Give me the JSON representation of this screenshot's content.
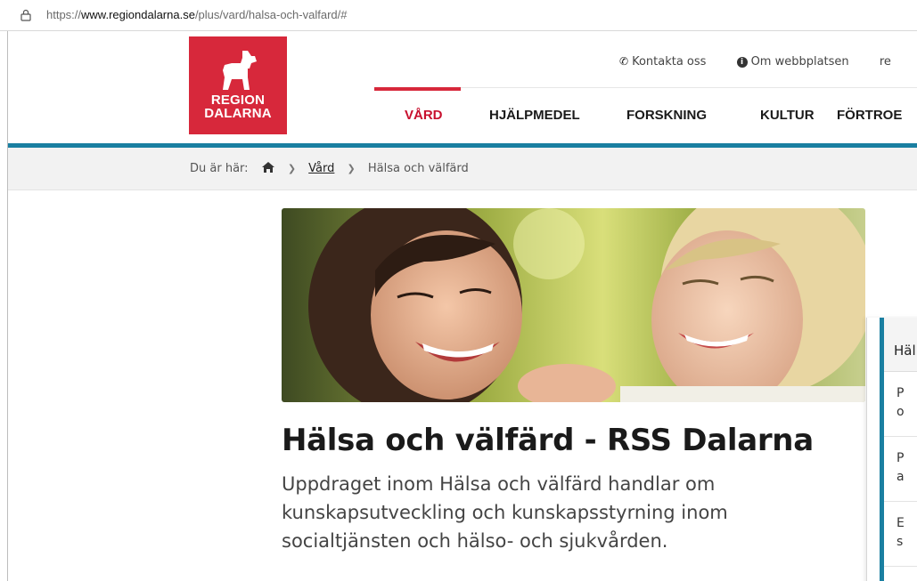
{
  "browser": {
    "url_protocol": "https://",
    "url_host": "www.regiondalarna.se",
    "url_path": "/plus/vard/halsa-och-valfard/#"
  },
  "header": {
    "logo_line1": "REGION",
    "logo_line2": "DALARNA",
    "top_links": {
      "contact": "Kontakta oss",
      "about": "Om webbplatsen",
      "more": "re"
    },
    "main_nav": [
      "VÅRD",
      "HJÄLPMEDEL",
      "FORSKNING",
      "KULTUR",
      "FÖRTROE"
    ],
    "active_index": 0
  },
  "breadcrumb": {
    "prefix": "Du är här:",
    "items": [
      "Vård",
      "Hälsa och välfärd"
    ]
  },
  "main": {
    "title": "Hälsa och välfärd - RSS Dalarna",
    "lead": "Uppdraget inom Hälsa och välfärd handlar om kunskapsutveckling och kunskapsstyrning inom socialtjänsten och hälso- och sjukvården."
  },
  "sidepanel": {
    "heading": "Häl",
    "items": [
      [
        "P",
        "o"
      ],
      [
        "P",
        "a"
      ],
      [
        "E",
        "s"
      ]
    ]
  },
  "colors": {
    "brand_red": "#d7283b",
    "accent_blue": "#1a7fa1"
  }
}
